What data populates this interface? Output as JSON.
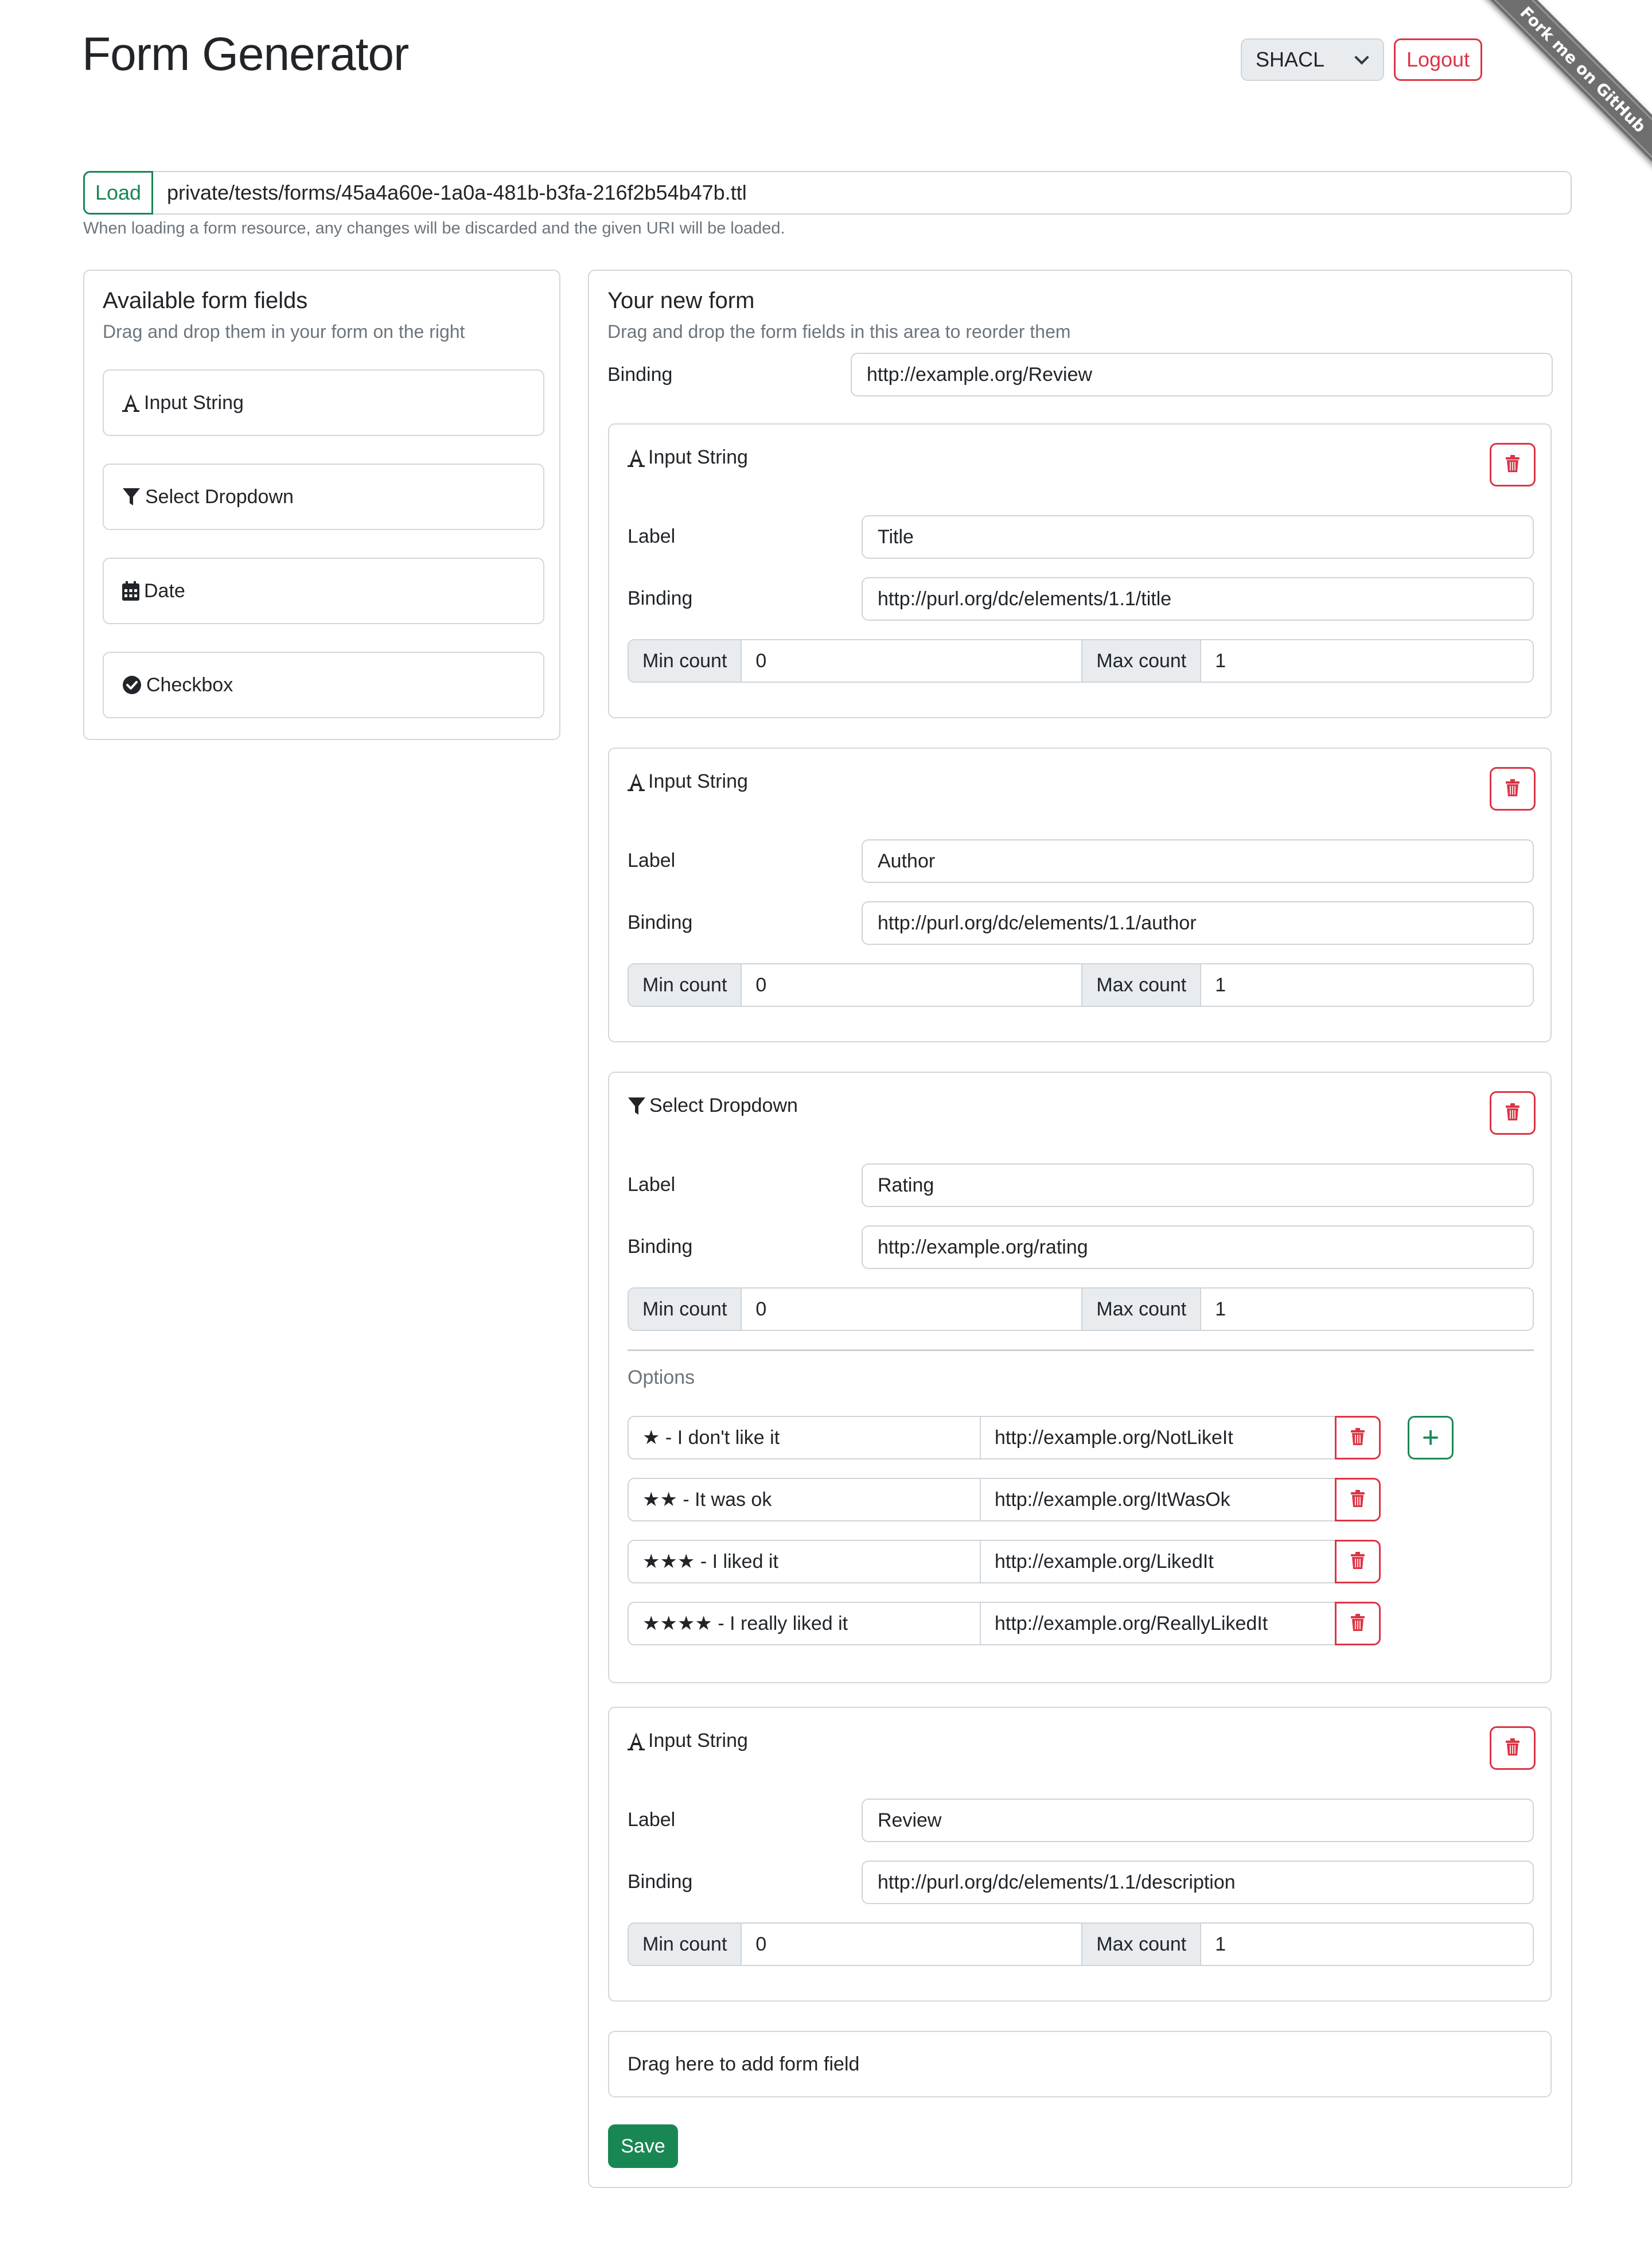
{
  "header": {
    "title": "Form Generator",
    "mode_select": {
      "selected": "SHACL"
    },
    "logout_label": "Logout",
    "ribbon_label": "Fork me on GitHub"
  },
  "loader": {
    "button_label": "Load",
    "value": "private/tests/forms/45a4a60e-1a0a-481b-b3fa-216f2b54b47b.ttl",
    "help": "When loading a form resource, any changes will be discarded and the given URI will be loaded."
  },
  "palette": {
    "title": "Available form fields",
    "subtitle": "Drag and drop them in your form on the right",
    "items": [
      {
        "label": "Input String",
        "icon": "font-icon"
      },
      {
        "label": "Select Dropdown",
        "icon": "filter-icon"
      },
      {
        "label": "Date",
        "icon": "calendar-icon"
      },
      {
        "label": "Checkbox",
        "icon": "check-circle-icon"
      }
    ]
  },
  "form": {
    "title": "Your new form",
    "subtitle": "Drag and drop the form fields in this area to reorder them",
    "binding_label": "Binding",
    "binding_value": "http://example.org/Review",
    "labels": {
      "label": "Label",
      "binding": "Binding",
      "min_count": "Min count",
      "max_count": "Max count",
      "options": "Options"
    },
    "fields": [
      {
        "type": "Input String",
        "icon": "font-icon",
        "label": "Title",
        "binding": "http://purl.org/dc/elements/1.1/title",
        "min": "0",
        "max": "1"
      },
      {
        "type": "Input String",
        "icon": "font-icon",
        "label": "Author",
        "binding": "http://purl.org/dc/elements/1.1/author",
        "min": "0",
        "max": "1"
      },
      {
        "type": "Select Dropdown",
        "icon": "filter-icon",
        "label": "Rating",
        "binding": "http://example.org/rating",
        "min": "0",
        "max": "1",
        "options": [
          {
            "label": "★ - I don't like it",
            "value": "http://example.org/NotLikeIt"
          },
          {
            "label": "★★ - It was ok",
            "value": "http://example.org/ItWasOk"
          },
          {
            "label": "★★★ - I liked it",
            "value": "http://example.org/LikedIt"
          },
          {
            "label": "★★★★ - I really liked it",
            "value": "http://example.org/ReallyLikedIt"
          }
        ]
      },
      {
        "type": "Input String",
        "icon": "font-icon",
        "label": "Review",
        "binding": "http://purl.org/dc/elements/1.1/description",
        "min": "0",
        "max": "1"
      }
    ],
    "drop_zone": "Drag here to add form field",
    "save_label": "Save",
    "add_option_symbol": "+"
  },
  "colors": {
    "success": "#198754",
    "danger": "#dc3545",
    "muted": "#6c757d",
    "addon_bg": "#e9ecef"
  }
}
